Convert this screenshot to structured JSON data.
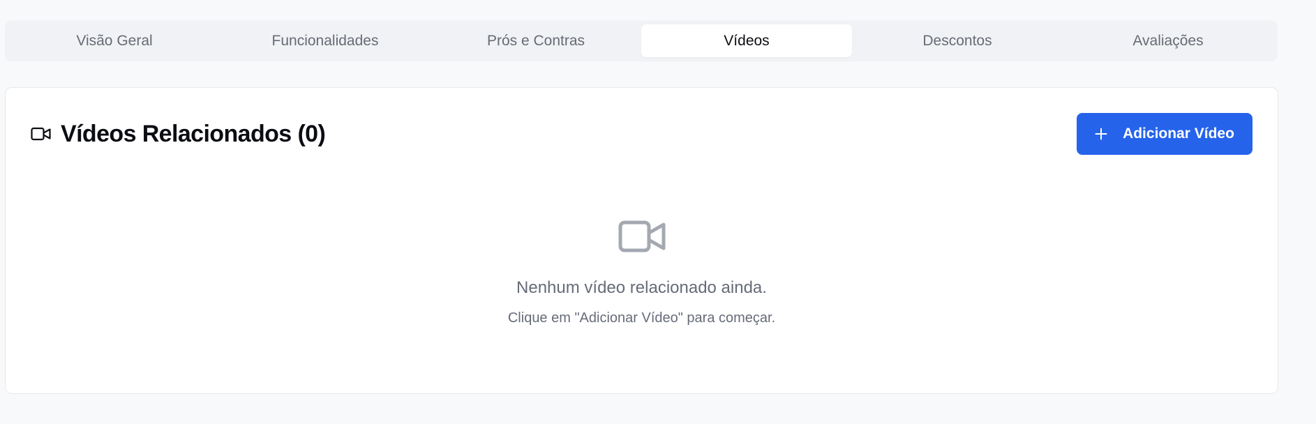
{
  "tabs": [
    {
      "label": "Visão Geral"
    },
    {
      "label": "Funcionalidades"
    },
    {
      "label": "Prós e Contras"
    },
    {
      "label": "Vídeos"
    },
    {
      "label": "Descontos"
    },
    {
      "label": "Avaliações"
    }
  ],
  "active_tab": "Vídeos",
  "section": {
    "icon": "video-camera-icon",
    "title": "Vídeos Relacionados (0)",
    "add_button": {
      "icon": "plus-icon",
      "label": "Adicionar Vídeo"
    }
  },
  "empty_state": {
    "icon": "video-camera-icon",
    "message": "Nenhum vídeo relacionado ainda.",
    "hint": "Clique em \"Adicionar Vídeo\" para começar."
  },
  "colors": {
    "accent": "#2563eb",
    "page_background": "#f8f9fb",
    "muted_text": "#666b78"
  }
}
